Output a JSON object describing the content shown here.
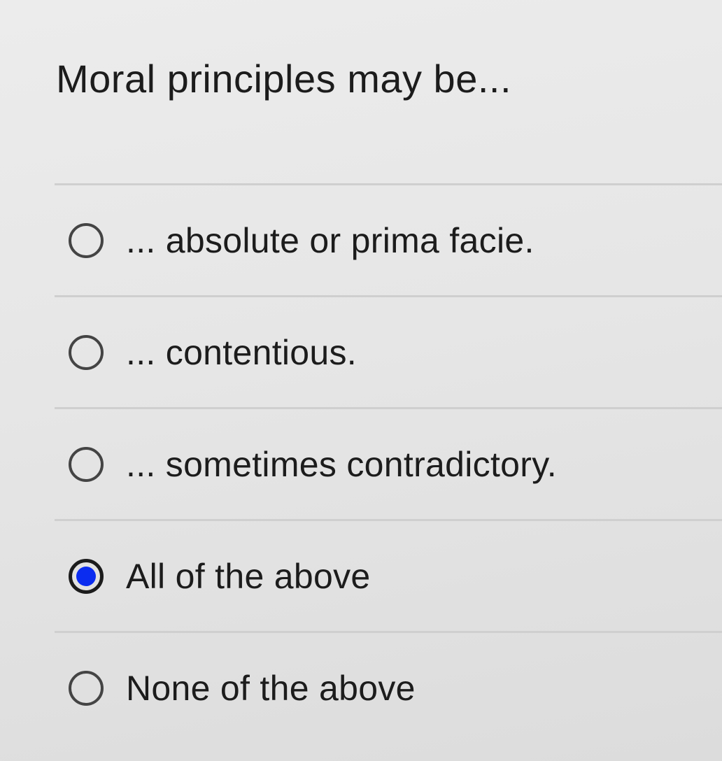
{
  "question": {
    "title": "Moral principles may be..."
  },
  "options": [
    {
      "label": "... absolute or prima facie.",
      "selected": false
    },
    {
      "label": "... contentious.",
      "selected": false
    },
    {
      "label": "... sometimes contradictory.",
      "selected": false
    },
    {
      "label": "All of the above",
      "selected": true
    },
    {
      "label": "None of the above",
      "selected": false
    }
  ],
  "colors": {
    "selected_radio": "#0b2cf0",
    "background": "#e6e6e6",
    "divider": "#cfcfcf"
  }
}
